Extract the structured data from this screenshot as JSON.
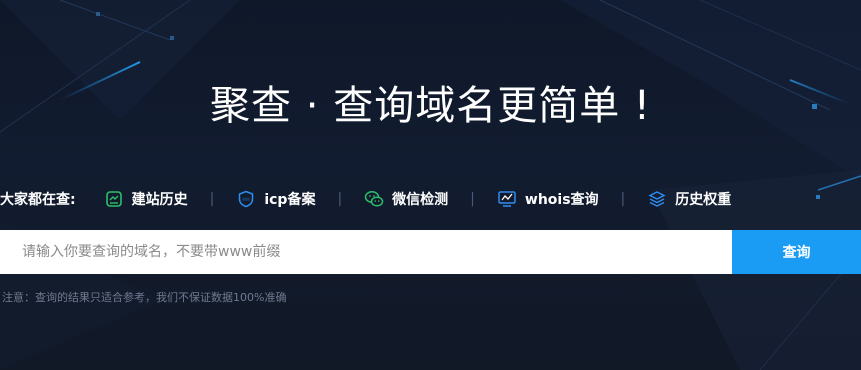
{
  "hero": {
    "headline": "聚查 · 查询域名更简单 !"
  },
  "hot": {
    "label": "大家都在查:",
    "separator": "|",
    "items": [
      {
        "label": "建站历史",
        "icon": "history-site-icon",
        "color": "#2bc06b"
      },
      {
        "label": "icp备案",
        "icon": "icp-shield-icon",
        "color": "#2e8ef0"
      },
      {
        "label": "微信检测",
        "icon": "wechat-icon",
        "color": "#2bc06b"
      },
      {
        "label": "whois查询",
        "icon": "whois-monitor-icon",
        "color": "#2e8ef0"
      },
      {
        "label": "历史权重",
        "icon": "layers-weight-icon",
        "color": "#2e8ef0"
      }
    ]
  },
  "search": {
    "placeholder": "请输入你要查询的域名，不要带www前缀",
    "value": "",
    "button_label": "查询"
  },
  "note": "注意：查询的结果只适合参考，我们不保证数据100%准确",
  "colors": {
    "accent": "#1a9cf5",
    "background": "#111a2b"
  }
}
